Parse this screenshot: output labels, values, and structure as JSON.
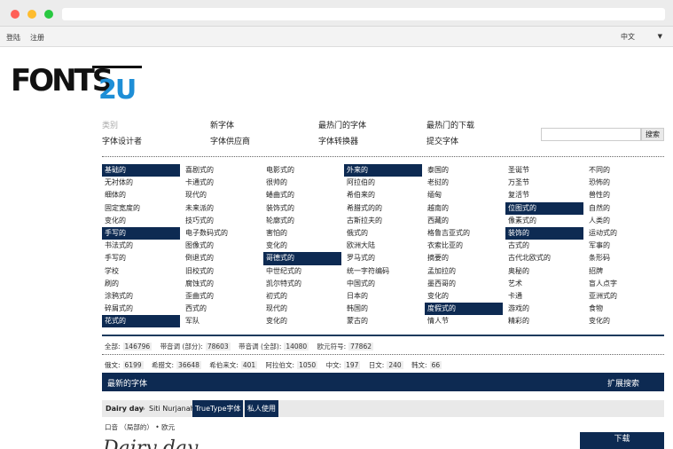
{
  "topbar": {
    "login": "登陆",
    "register": "注册",
    "language": "中文"
  },
  "logo": {
    "text_a": "FONTS",
    "text_b": "2U"
  },
  "nav": {
    "row1": [
      "类别",
      "新字体",
      "最热门的字体",
      "最热门的下载"
    ],
    "row2": [
      "字体设计者",
      "字体供应商",
      "字体转换器",
      "提交字体"
    ],
    "search_button": "搜索"
  },
  "categories": [
    [
      {
        "t": "基础的",
        "hl": true
      },
      {
        "t": "无衬体的"
      },
      {
        "t": "细体的"
      },
      {
        "t": "固定宽度的"
      },
      {
        "t": "变化的"
      },
      {
        "t": "手写的",
        "hl": true
      },
      {
        "t": "书法式的"
      },
      {
        "t": "手写的"
      },
      {
        "t": "学校"
      },
      {
        "t": "刷的"
      },
      {
        "t": "涂鸦式的"
      },
      {
        "t": "碎屑式的"
      },
      {
        "t": "花式的",
        "hl": true
      }
    ],
    [
      {
        "t": "喜剧式的"
      },
      {
        "t": "卡通式的"
      },
      {
        "t": "现代的"
      },
      {
        "t": "未来派的"
      },
      {
        "t": "技巧式的"
      },
      {
        "t": "电子数码式的"
      },
      {
        "t": "图像式的"
      },
      {
        "t": "倒退式的"
      },
      {
        "t": "旧校式的"
      },
      {
        "t": "腐蚀式的"
      },
      {
        "t": "歪曲式的"
      },
      {
        "t": "西式的"
      },
      {
        "t": "军队"
      }
    ],
    [
      {
        "t": "电影式的"
      },
      {
        "t": "很帅的"
      },
      {
        "t": "蜷曲式的"
      },
      {
        "t": "装饰式的"
      },
      {
        "t": "轮廓式的"
      },
      {
        "t": "害怕的"
      },
      {
        "t": "变化的"
      },
      {
        "t": "哥德式的",
        "hl": true
      },
      {
        "t": "中世纪式的"
      },
      {
        "t": "凯尔特式的"
      },
      {
        "t": "初式的"
      },
      {
        "t": "现代的"
      },
      {
        "t": "变化的"
      }
    ],
    [
      {
        "t": "外来的",
        "hl": true
      },
      {
        "t": "阿拉伯的"
      },
      {
        "t": "希伯来的"
      },
      {
        "t": "希腊式的的"
      },
      {
        "t": "古斯拉夫的"
      },
      {
        "t": "俄式的"
      },
      {
        "t": "欧洲大陆"
      },
      {
        "t": "罗马式的"
      },
      {
        "t": "统一字符编码"
      },
      {
        "t": "中国式的"
      },
      {
        "t": "日本的"
      },
      {
        "t": "韩国的"
      },
      {
        "t": "蒙古的"
      }
    ],
    [
      {
        "t": "泰国的"
      },
      {
        "t": "老挝的"
      },
      {
        "t": "缅甸"
      },
      {
        "t": "越南的"
      },
      {
        "t": "西藏的"
      },
      {
        "t": "格鲁吉亚式的"
      },
      {
        "t": "衣索比亚的"
      },
      {
        "t": "摘要的"
      },
      {
        "t": "孟加拉的"
      },
      {
        "t": "墨西哥的"
      },
      {
        "t": "变化的"
      },
      {
        "t": "度假式的",
        "hl": true
      },
      {
        "t": "情人节"
      }
    ],
    [
      {
        "t": "圣诞节"
      },
      {
        "t": "万圣节"
      },
      {
        "t": "复活节"
      },
      {
        "t": "位图式的",
        "hl": true
      },
      {
        "t": "像素式的"
      },
      {
        "t": "装饰的",
        "hl": true
      },
      {
        "t": "古式的"
      },
      {
        "t": "古代北欧式的"
      },
      {
        "t": "奥秘的"
      },
      {
        "t": "艺术"
      },
      {
        "t": "卡通"
      },
      {
        "t": "游戏的"
      },
      {
        "t": "精彩的"
      }
    ],
    [
      {
        "t": "不同的"
      },
      {
        "t": "恐怖的"
      },
      {
        "t": "兽性的"
      },
      {
        "t": "自然的"
      },
      {
        "t": "人类的"
      },
      {
        "t": "运动式的"
      },
      {
        "t": "军事的"
      },
      {
        "t": "条形码"
      },
      {
        "t": "招牌"
      },
      {
        "t": "盲人点字"
      },
      {
        "t": "亚洲式的"
      },
      {
        "t": "食物"
      },
      {
        "t": "变化的"
      }
    ]
  ],
  "stats1": [
    {
      "label": "全部:",
      "value": "146796"
    },
    {
      "label": "带音调 (部分):",
      "value": "78603"
    },
    {
      "label": "带音调 (全部):",
      "value": "14080"
    },
    {
      "label": "欧元符号:",
      "value": "77862"
    }
  ],
  "stats2": [
    {
      "label": "俄文:",
      "value": "6199"
    },
    {
      "label": "希腊文:",
      "value": "36648"
    },
    {
      "label": "希伯来文:",
      "value": "401"
    },
    {
      "label": "阿拉伯文:",
      "value": "1050"
    },
    {
      "label": "中文:",
      "value": "197"
    },
    {
      "label": "日文:",
      "value": "240"
    },
    {
      "label": "韩文:",
      "value": "66"
    }
  ],
  "latest": {
    "title": "最新的字体",
    "advanced": "扩展搜索"
  },
  "font_item": {
    "name": "Dairy day",
    "sep": "»",
    "author": "Siti Nurjanah",
    "tag1": "TrueType字体",
    "tag2": "私人使用",
    "meta": "口音 （局部的）  • 欧元",
    "download": "下载",
    "preview": "Dairy day"
  },
  "colors": {
    "accent": "#0d2a52",
    "logo_blue": "#1e8ed6"
  }
}
